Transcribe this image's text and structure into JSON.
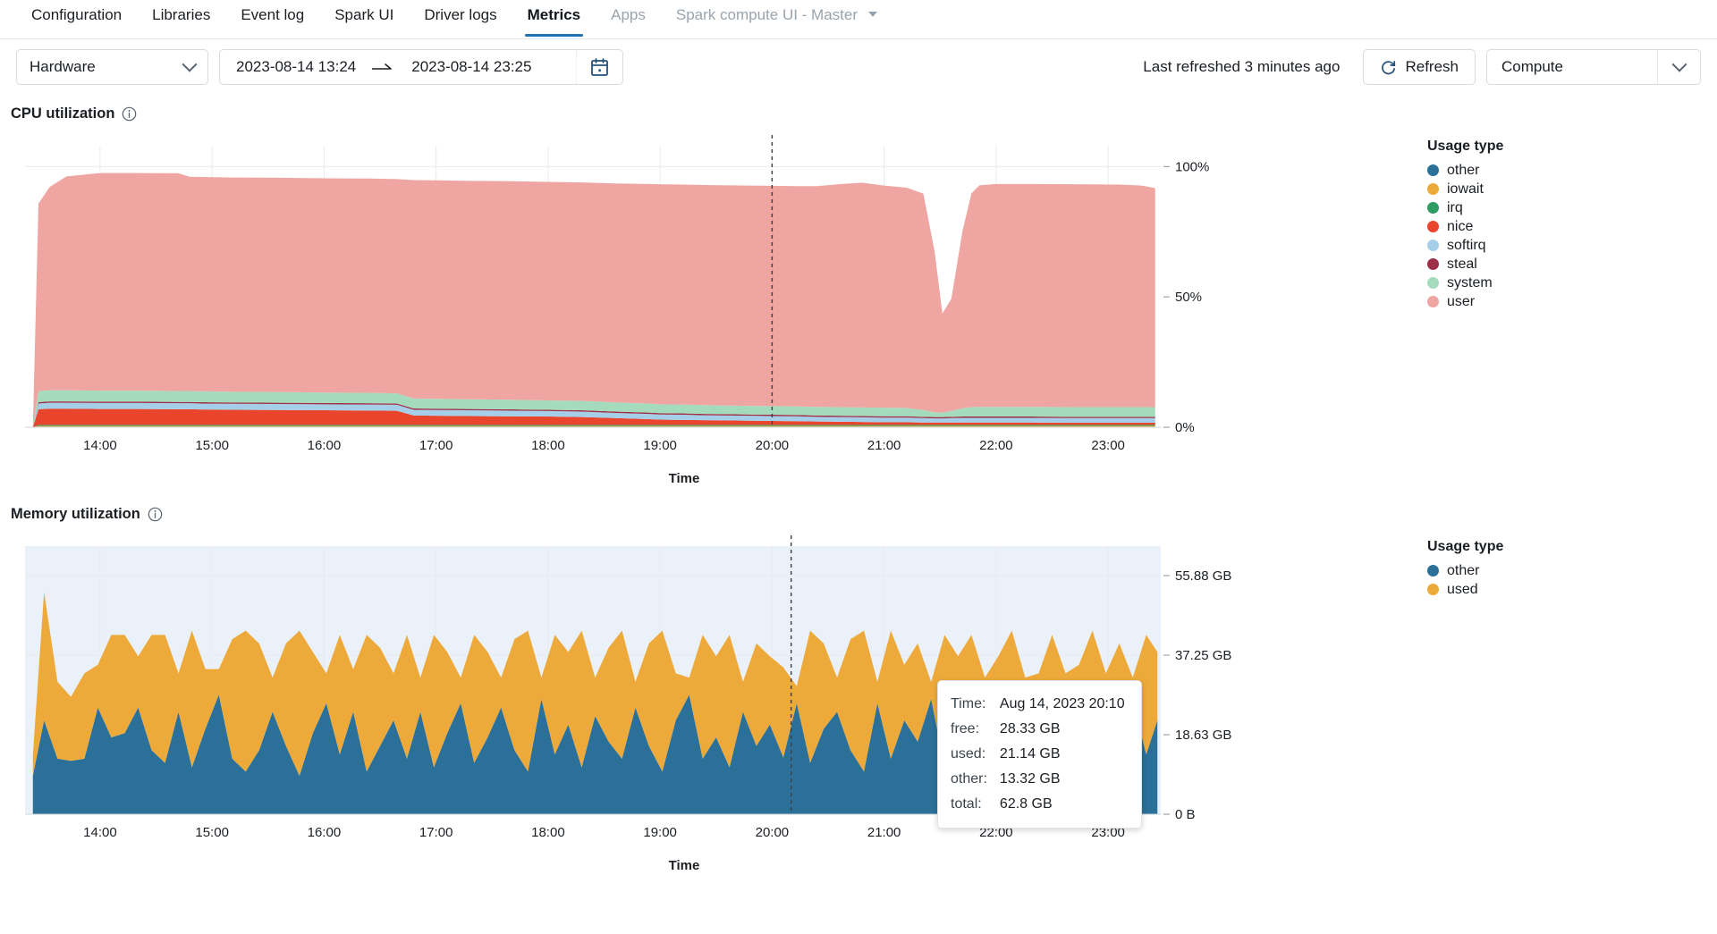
{
  "tabs": [
    {
      "label": "Configuration",
      "state": "normal"
    },
    {
      "label": "Libraries",
      "state": "normal"
    },
    {
      "label": "Event log",
      "state": "normal"
    },
    {
      "label": "Spark UI",
      "state": "normal"
    },
    {
      "label": "Driver logs",
      "state": "normal"
    },
    {
      "label": "Metrics",
      "state": "active"
    },
    {
      "label": "Apps",
      "state": "muted"
    },
    {
      "label": "Spark compute UI - Master",
      "state": "muted",
      "caret": true
    }
  ],
  "toolbar": {
    "hardware_select": "Hardware",
    "date_from": "2023-08-14 13:24",
    "date_to": "2023-08-14 23:25",
    "range_arrow_icon": "arrow-right-icon",
    "calendar_icon": "calendar-icon",
    "last_refreshed": "Last refreshed 3 minutes ago",
    "refresh_label": "Refresh",
    "refresh_icon": "refresh-icon",
    "compute_select": "Compute"
  },
  "cpu": {
    "title": "CPU utilization",
    "info_icon": "info-icon",
    "legend_title": "Usage type"
  },
  "memory": {
    "title": "Memory utilization",
    "info_icon": "info-icon",
    "legend_title": "Usage type",
    "tooltip": {
      "rows": [
        {
          "key": "Time:",
          "value": "Aug 14, 2023 20:10"
        },
        {
          "key": "free:",
          "value": "28.33 GB"
        },
        {
          "key": "used:",
          "value": "21.14 GB"
        },
        {
          "key": "other:",
          "value": "13.32 GB"
        },
        {
          "key": "total:",
          "value": "62.8 GB"
        }
      ]
    }
  },
  "chart_data": [
    {
      "type": "area",
      "id": "cpu-utilization",
      "title": "CPU utilization",
      "stacked": true,
      "xlabel": "Time",
      "ylabel": "",
      "xticks": [
        "14:00",
        "15:00",
        "16:00",
        "17:00",
        "18:00",
        "19:00",
        "20:00",
        "21:00",
        "22:00",
        "23:00"
      ],
      "yticks": [
        "0%",
        "50%",
        "100%"
      ],
      "ylim": [
        0,
        100
      ],
      "grid": true,
      "legend_position": "right",
      "legend_title": "Usage type",
      "cursor_time": "20:00",
      "x": [
        13.4,
        13.45,
        13.55,
        13.7,
        14.0,
        14.35,
        14.7,
        14.8,
        14.9,
        15.2,
        15.6,
        16.0,
        16.4,
        16.65,
        16.8,
        17.0,
        17.3,
        17.6,
        18.0,
        18.3,
        18.6,
        18.9,
        19.0,
        19.2,
        19.4,
        19.6,
        19.8,
        20.0,
        20.2,
        20.4,
        20.6,
        20.8,
        21.0,
        21.2,
        21.35,
        21.45,
        21.52,
        21.6,
        21.7,
        21.78,
        21.85,
        22.0,
        22.3,
        22.7,
        23.1,
        23.3,
        23.42
      ],
      "series": [
        {
          "name": "other",
          "color": "#2a7099",
          "values": [
            0.0,
            0.2,
            0.2,
            0.2,
            0.2,
            0.2,
            0.2,
            0.2,
            0.2,
            0.2,
            0.2,
            0.2,
            0.2,
            0.2,
            0.2,
            0.2,
            0.2,
            0.2,
            0.2,
            0.2,
            0.2,
            0.2,
            0.2,
            0.2,
            0.2,
            0.2,
            0.2,
            0.2,
            0.2,
            0.2,
            0.2,
            0.2,
            0.2,
            0.2,
            0.2,
            0.2,
            0.2,
            0.2,
            0.2,
            0.2,
            0.2,
            0.2,
            0.2,
            0.2,
            0.2,
            0.2,
            0.2
          ]
        },
        {
          "name": "iowait",
          "color": "#edaa3b",
          "values": [
            0.0,
            0.3,
            0.3,
            0.3,
            0.3,
            0.3,
            0.3,
            0.3,
            0.3,
            0.3,
            0.3,
            0.3,
            0.3,
            0.3,
            0.3,
            0.3,
            0.3,
            0.3,
            0.3,
            0.3,
            0.3,
            0.3,
            0.3,
            0.3,
            0.3,
            0.3,
            0.3,
            0.3,
            0.3,
            0.3,
            0.3,
            0.3,
            0.3,
            0.3,
            0.3,
            0.3,
            0.3,
            0.3,
            0.3,
            0.3,
            0.3,
            0.3,
            0.3,
            0.3,
            0.3,
            0.3,
            0.3
          ]
        },
        {
          "name": "irq",
          "color": "#2d9d62",
          "values": [
            0.0,
            0.4,
            0.4,
            0.4,
            0.4,
            0.4,
            0.4,
            0.4,
            0.4,
            0.4,
            0.4,
            0.4,
            0.4,
            0.4,
            0.4,
            0.4,
            0.4,
            0.4,
            0.4,
            0.4,
            0.4,
            0.4,
            0.4,
            0.4,
            0.4,
            0.4,
            0.4,
            0.4,
            0.4,
            0.4,
            0.4,
            0.4,
            0.4,
            0.4,
            0.4,
            0.4,
            0.4,
            0.4,
            0.4,
            0.4,
            0.4,
            0.4,
            0.4,
            0.4,
            0.4,
            0.4,
            0.4
          ]
        },
        {
          "name": "nice",
          "color": "#e8452c",
          "values": [
            0.0,
            6.0,
            6.2,
            6.2,
            6.1,
            6.1,
            6.0,
            6.0,
            5.9,
            5.8,
            5.7,
            5.6,
            5.5,
            5.4,
            3.6,
            3.5,
            3.4,
            3.3,
            3.2,
            3.0,
            2.6,
            2.2,
            2.0,
            1.9,
            1.8,
            1.7,
            1.6,
            1.5,
            1.4,
            1.3,
            1.2,
            1.1,
            1.0,
            1.0,
            0.9,
            0.9,
            0.9,
            0.9,
            0.9,
            0.9,
            0.9,
            0.9,
            0.9,
            0.8,
            0.8,
            0.8,
            0.8
          ]
        },
        {
          "name": "softirq",
          "color": "#a5cfe8",
          "values": [
            0.0,
            2.2,
            2.3,
            2.3,
            2.3,
            2.3,
            2.3,
            2.3,
            2.3,
            2.3,
            2.3,
            2.3,
            2.3,
            2.3,
            2.2,
            2.2,
            2.2,
            2.2,
            2.1,
            2.1,
            2.0,
            2.0,
            2.0,
            2.0,
            1.9,
            1.9,
            1.9,
            1.9,
            1.9,
            1.8,
            1.8,
            1.8,
            1.8,
            1.8,
            1.7,
            1.6,
            1.6,
            1.7,
            1.8,
            1.8,
            1.8,
            1.8,
            1.8,
            1.8,
            1.8,
            1.8,
            1.8
          ]
        },
        {
          "name": "steal",
          "color": "#9c2f47",
          "values": [
            0.0,
            0.5,
            0.5,
            0.5,
            0.5,
            0.5,
            0.5,
            0.5,
            0.5,
            0.5,
            0.5,
            0.5,
            0.5,
            0.5,
            0.5,
            0.5,
            0.5,
            0.5,
            0.5,
            0.5,
            0.5,
            0.5,
            0.5,
            0.5,
            0.5,
            0.5,
            0.5,
            0.5,
            0.5,
            0.5,
            0.5,
            0.5,
            0.5,
            0.5,
            0.5,
            0.5,
            0.5,
            0.5,
            0.5,
            0.5,
            0.5,
            0.5,
            0.5,
            0.5,
            0.5,
            0.5,
            0.5
          ]
        },
        {
          "name": "system",
          "color": "#a5dbbd",
          "values": [
            0.0,
            4.2,
            4.3,
            4.3,
            4.2,
            4.2,
            4.2,
            4.2,
            4.2,
            4.1,
            4.1,
            4.0,
            4.0,
            3.9,
            3.8,
            3.8,
            3.7,
            3.7,
            3.6,
            3.6,
            3.5,
            3.5,
            3.4,
            3.4,
            3.4,
            3.3,
            3.3,
            3.3,
            3.3,
            3.3,
            3.3,
            3.3,
            3.3,
            3.2,
            2.6,
            1.8,
            1.7,
            2.2,
            3.2,
            3.6,
            3.7,
            3.7,
            3.7,
            3.7,
            3.7,
            3.7,
            3.7
          ]
        },
        {
          "name": "user",
          "color": "#efa5a2",
          "values": [
            0.0,
            72.0,
            78.0,
            82.0,
            83.5,
            83.5,
            83.5,
            82.2,
            82.2,
            82.2,
            82.2,
            82.2,
            82.2,
            82.2,
            83.8,
            83.8,
            83.8,
            83.8,
            83.8,
            83.8,
            84.0,
            84.2,
            84.4,
            84.4,
            84.4,
            84.5,
            84.5,
            84.5,
            84.5,
            84.7,
            85.5,
            86.2,
            85.2,
            84.5,
            83.0,
            62.0,
            38.0,
            43.0,
            68.0,
            82.0,
            85.0,
            85.5,
            85.5,
            85.5,
            85.4,
            85.0,
            84.0
          ]
        }
      ]
    },
    {
      "type": "area",
      "id": "memory-utilization",
      "title": "Memory utilization",
      "stacked": true,
      "xlabel": "Time",
      "ylabel": "",
      "xticks": [
        "14:00",
        "15:00",
        "16:00",
        "17:00",
        "18:00",
        "19:00",
        "20:00",
        "21:00",
        "22:00",
        "23:00"
      ],
      "yticks": [
        "0 B",
        "18.63 GB",
        "37.25 GB",
        "55.88 GB"
      ],
      "ylim": [
        0,
        62.8
      ],
      "total_gb": 62.8,
      "grid": true,
      "legend_position": "right",
      "legend_title": "Usage type",
      "cursor_time": "20:10",
      "x": [
        13.4,
        13.5,
        13.62,
        13.74,
        13.86,
        13.98,
        14.1,
        14.22,
        14.34,
        14.46,
        14.58,
        14.7,
        14.82,
        14.94,
        15.06,
        15.18,
        15.3,
        15.42,
        15.54,
        15.66,
        15.78,
        15.9,
        16.02,
        16.14,
        16.26,
        16.38,
        16.5,
        16.62,
        16.74,
        16.86,
        16.98,
        17.1,
        17.22,
        17.34,
        17.46,
        17.58,
        17.7,
        17.82,
        17.94,
        18.06,
        18.18,
        18.3,
        18.42,
        18.54,
        18.66,
        18.78,
        18.9,
        19.02,
        19.14,
        19.26,
        19.38,
        19.5,
        19.62,
        19.74,
        19.86,
        19.98,
        20.1,
        20.22,
        20.34,
        20.46,
        20.58,
        20.7,
        20.82,
        20.94,
        21.06,
        21.18,
        21.3,
        21.42,
        21.54,
        21.66,
        21.78,
        21.9,
        22.02,
        22.14,
        22.26,
        22.38,
        22.5,
        22.62,
        22.74,
        22.86,
        22.98,
        23.1,
        23.22,
        23.34,
        23.44
      ],
      "series": [
        {
          "name": "other",
          "color": "#2a7099",
          "values": [
            9.0,
            22.0,
            13.0,
            12.5,
            13.0,
            25.0,
            18.0,
            19.0,
            25.0,
            15.0,
            12.0,
            24.0,
            11.0,
            20.0,
            28.0,
            13.0,
            10.0,
            15.0,
            24.0,
            16.0,
            9.0,
            19.0,
            26.0,
            14.0,
            24.0,
            10.0,
            16.0,
            22.0,
            13.0,
            24.0,
            11.0,
            19.0,
            26.0,
            12.0,
            18.0,
            25.0,
            15.0,
            10.0,
            27.0,
            14.0,
            21.0,
            11.0,
            23.0,
            17.0,
            13.0,
            25.0,
            16.0,
            10.0,
            22.0,
            28.0,
            13.0,
            18.0,
            11.0,
            24.0,
            16.0,
            21.0,
            13.3,
            26.0,
            12.0,
            20.0,
            24.0,
            15.0,
            10.0,
            26.0,
            13.0,
            22.0,
            17.0,
            27.0,
            11.0,
            21.0,
            15.0,
            25.0,
            18.0,
            12.0,
            29.0,
            23.0,
            16.0,
            26.0,
            21.0,
            13.0,
            24.0,
            18.0,
            27.0,
            14.0,
            22.0
          ]
        },
        {
          "name": "used",
          "color": "#edaa3b",
          "values": [
            5.0,
            30.0,
            18.0,
            15.0,
            20.0,
            10.0,
            24.0,
            23.0,
            12.0,
            27.0,
            30.0,
            9.0,
            32.0,
            14.0,
            6.0,
            28.0,
            33.0,
            25.0,
            8.0,
            24.0,
            34.0,
            19.0,
            7.0,
            28.0,
            10.0,
            32.0,
            23.0,
            11.0,
            29.0,
            8.0,
            31.0,
            19.0,
            6.0,
            30.0,
            20.0,
            7.0,
            26.0,
            33.0,
            5.0,
            28.0,
            17.0,
            32.0,
            9.0,
            22.0,
            30.0,
            6.0,
            24.0,
            33.0,
            11.0,
            4.0,
            29.0,
            19.0,
            31.0,
            7.0,
            24.0,
            16.0,
            21.1,
            4.0,
            31.0,
            20.0,
            8.0,
            26.0,
            33.0,
            5.0,
            30.0,
            13.0,
            23.0,
            4.0,
            31.0,
            16.0,
            27.0,
            7.0,
            19.0,
            31.0,
            3.0,
            10.0,
            26.0,
            7.0,
            14.0,
            30.0,
            9.0,
            22.0,
            5.0,
            28.0,
            16.0
          ]
        }
      ]
    }
  ]
}
